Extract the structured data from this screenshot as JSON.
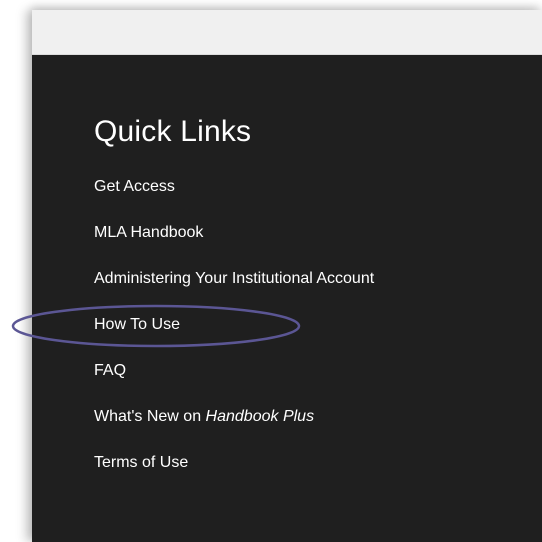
{
  "quick_links": {
    "title": "Quick Links",
    "items": [
      {
        "label": "Get Access"
      },
      {
        "label": "MLA Handbook"
      },
      {
        "label": "Administering Your Institutional Account"
      },
      {
        "label": "How To Use"
      },
      {
        "label": "FAQ"
      },
      {
        "label_prefix": "What's New on ",
        "label_emphasis": "Handbook Plus"
      },
      {
        "label": "Terms of Use"
      }
    ]
  },
  "colors": {
    "panel_background": "#1f1f1f",
    "top_bar": "#f0f0f0",
    "text": "#ffffff",
    "highlight_outline": "#5b5694"
  }
}
